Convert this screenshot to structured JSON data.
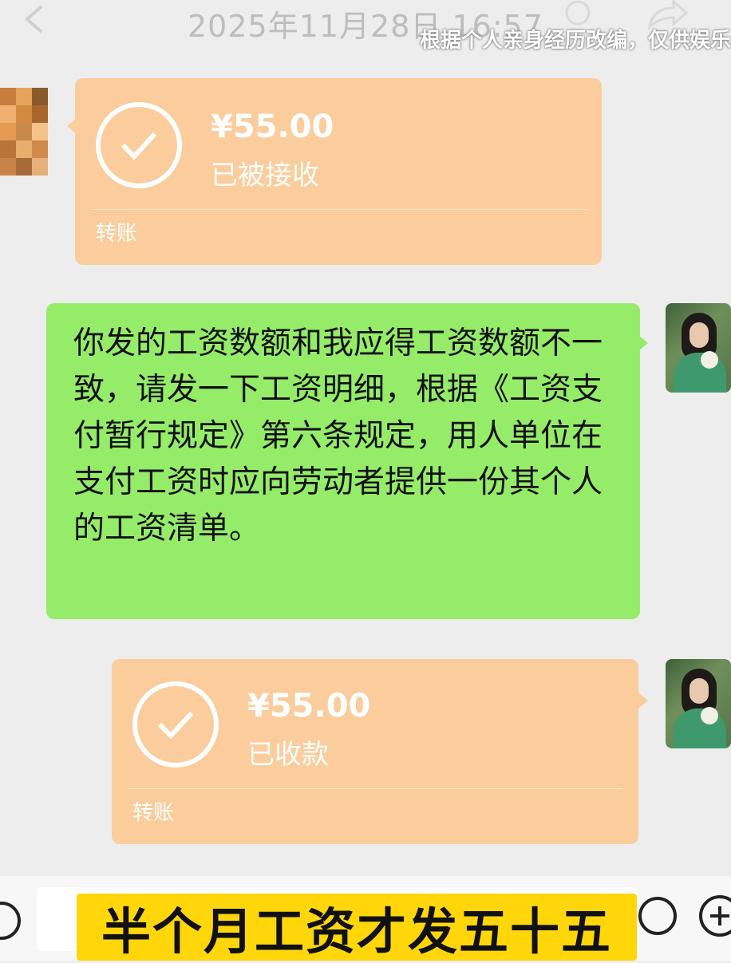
{
  "header": {
    "timestamp": "2025年11月28日 16:57",
    "overlay_caption": "根据个人亲身经历改编，仅供娱乐"
  },
  "messages": [
    {
      "type": "transfer",
      "side": "left",
      "amount": "¥55.00",
      "status": "已被接收",
      "label": "转账"
    },
    {
      "type": "text",
      "side": "right",
      "text": "你发的工资数额和我应得工资数额不一致，请发一下工资明细，根据《工资支付暂行规定》第六条规定，用人单位在支付工资时应向劳动者提供一份其个人的工资清单。"
    },
    {
      "type": "transfer",
      "side": "right",
      "amount": "¥55.00",
      "status": "已收款",
      "label": "转账"
    }
  ],
  "banner": {
    "text": "半个月工资才发五十五"
  },
  "colors": {
    "transfer_bubble": "#fbcd9c",
    "text_bubble": "#95ec69",
    "background": "#ededed",
    "banner": "#ffd60a"
  },
  "icons": [
    "back-arrow-icon",
    "check-circle-icon",
    "voice-icon",
    "emoji-icon",
    "plus-icon"
  ]
}
